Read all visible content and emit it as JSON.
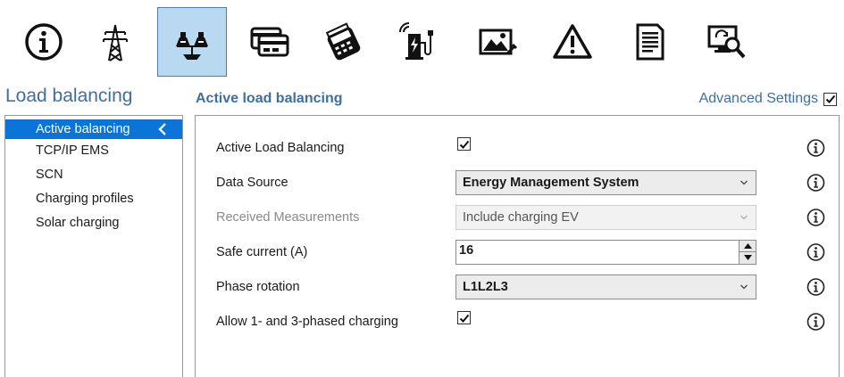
{
  "toolbar": {
    "items": [
      {
        "name": "info-icon"
      },
      {
        "name": "power-grid-icon"
      },
      {
        "name": "load-balancing-icon",
        "active": true
      },
      {
        "name": "payment-card-icon"
      },
      {
        "name": "card-terminal-icon"
      },
      {
        "name": "ev-charger-icon"
      },
      {
        "name": "display-image-icon"
      },
      {
        "name": "warning-icon"
      },
      {
        "name": "document-icon"
      },
      {
        "name": "remote-diagnostics-icon"
      }
    ]
  },
  "section": {
    "title": "Load balancing"
  },
  "sidebar": {
    "items": [
      {
        "label": "Active balancing",
        "selected": true
      },
      {
        "label": "TCP/IP EMS"
      },
      {
        "label": "SCN"
      },
      {
        "label": "Charging profiles"
      },
      {
        "label": "Solar charging"
      }
    ]
  },
  "panel": {
    "title": "Active load balancing",
    "advanced_label": "Advanced Settings",
    "advanced_checked": true,
    "rows": {
      "active_lb": {
        "label": "Active Load Balancing",
        "checked": true
      },
      "data_source": {
        "label": "Data Source",
        "value": "Energy Management System"
      },
      "received": {
        "label": "Received Measurements",
        "value": "Include charging EV",
        "disabled": true
      },
      "safe_current": {
        "label": "Safe current (A)",
        "value": "16"
      },
      "phase_rotation": {
        "label": "Phase rotation",
        "value": "L1L2L3"
      },
      "allow_phased": {
        "label": "Allow 1- and 3-phased charging",
        "checked": true
      }
    }
  },
  "colors": {
    "accent": "#3e6f9f",
    "selection": "#0a74d8",
    "active_tool": "#b9d9f0"
  }
}
